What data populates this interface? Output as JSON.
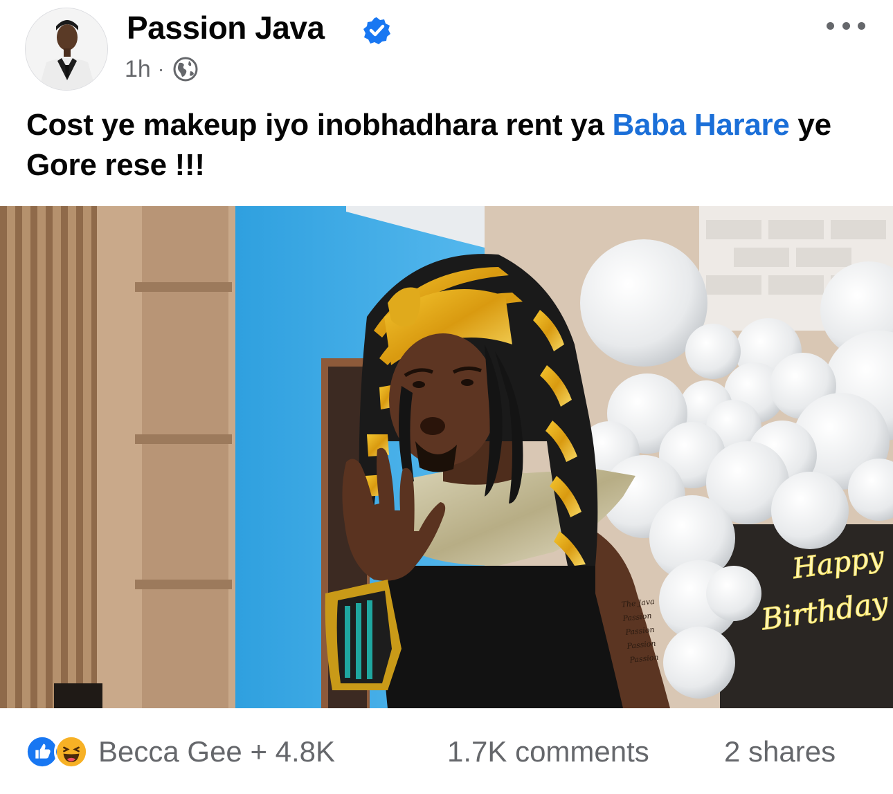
{
  "post": {
    "author": {
      "name": "Passion Java",
      "verified": true,
      "avatar_icon": "profile-photo"
    },
    "timestamp": "1h",
    "separator": "·",
    "audience_icon": "globe-icon",
    "caption": {
      "part1": "Cost ye makeup iyo inobhadhara rent ya ",
      "link": "Baba Harare",
      "part2": " ye Gore rese !!!"
    },
    "image": {
      "neon_text_line1": "Happy",
      "neon_text_line2": "Birthday"
    }
  },
  "engagement": {
    "reaction_icons": [
      "like-icon",
      "haha-icon"
    ],
    "reactions_text": "Becca Gee + 4.8K",
    "comments": "1.7K comments",
    "shares": "2 shares"
  },
  "colors": {
    "link": "#1b6fd8",
    "muted": "#65676b",
    "like_blue": "#1877f2",
    "haha_yellow": "#f7b125",
    "verified_blue": "#1877f2"
  }
}
